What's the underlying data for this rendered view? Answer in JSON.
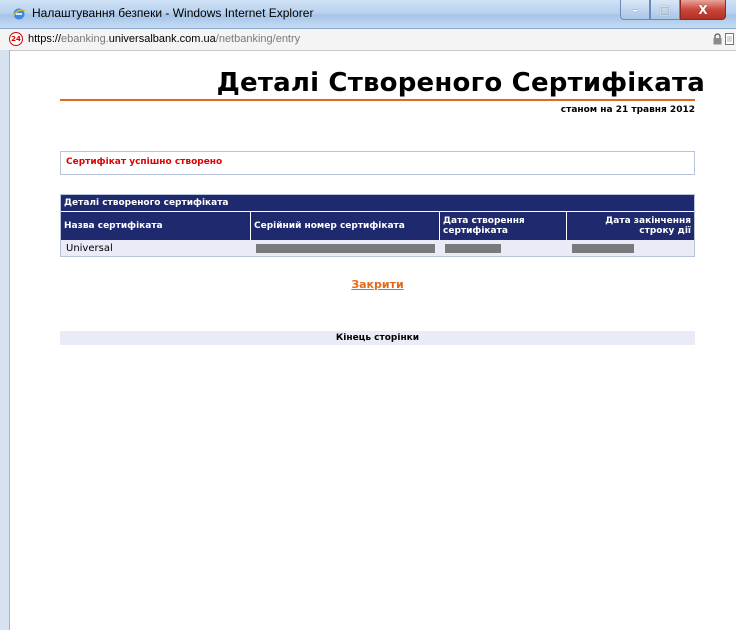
{
  "window": {
    "title": "Налаштування безпеки - Windows Internet Explorer",
    "controls": {
      "minimize": "–",
      "maximize": "□",
      "close": "X"
    }
  },
  "address_bar": {
    "site_badge": "24",
    "url_protocol": "https://",
    "url_subdomain": "ebanking.",
    "url_domain": "universalbank.com.ua",
    "url_path": "/netbanking/entry"
  },
  "page": {
    "title": "Деталі Створеного Сертифіката",
    "date_text": "станом на 21 травня 2012",
    "success_message": "Сертифікат успішно створено",
    "table": {
      "caption": "Деталі створеного сертифіката",
      "columns": [
        "Назва сертифіката",
        "Серійний номер сертифіката",
        "Дата створення сертифіката",
        "Дата закінчення строку дії"
      ],
      "rows": [
        {
          "name": "Universal"
        }
      ]
    },
    "close_link": "Закрити",
    "page_end": "Кінець сторінки"
  },
  "colors": {
    "accent_orange": "#e06a1a",
    "table_header": "#1f2a6e",
    "success_red": "#e00000",
    "row_bg": "#e9ecf6"
  }
}
